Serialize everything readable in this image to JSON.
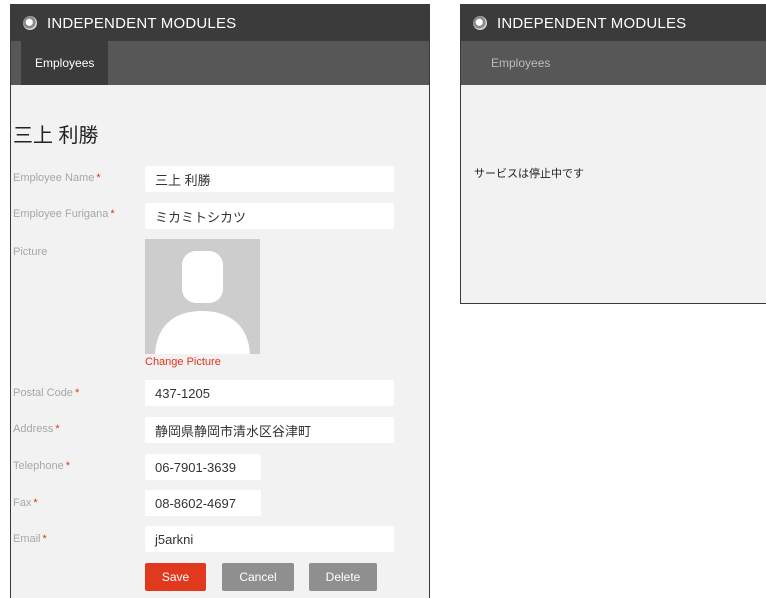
{
  "left_panel": {
    "app_title": "INDEPENDENT MODULES",
    "tab_label": "Employees",
    "record_title": "三上 利勝",
    "fields": {
      "employee_name": {
        "label": "Employee Name",
        "value": "三上 利勝"
      },
      "employee_furigana": {
        "label": "Employee Furigana",
        "value": "ミカミトシカツ"
      },
      "picture": {
        "label": "Picture"
      },
      "postal_code": {
        "label": "Postal Code",
        "value": "437-1205"
      },
      "address": {
        "label": "Address",
        "value": "静岡県静岡市清水区谷津町"
      },
      "telephone": {
        "label": "Telephone",
        "value": "06-7901-3639"
      },
      "fax": {
        "label": "Fax",
        "value": "08-8602-4697"
      },
      "email": {
        "label": "Email",
        "value": "j5arkni"
      }
    },
    "required_mark": "*",
    "change_picture": "Change Picture",
    "buttons": {
      "save": "Save",
      "cancel": "Cancel",
      "delete": "Delete"
    }
  },
  "right_panel": {
    "app_title": "INDEPENDENT MODULES",
    "tab_label": "Employees",
    "message": "サービスは停止中です"
  },
  "colors": {
    "accent_red": "#e0391e",
    "titlebar": "#3b3b3b",
    "tabbar": "#575757",
    "panel_bg": "#f2f2f2"
  }
}
